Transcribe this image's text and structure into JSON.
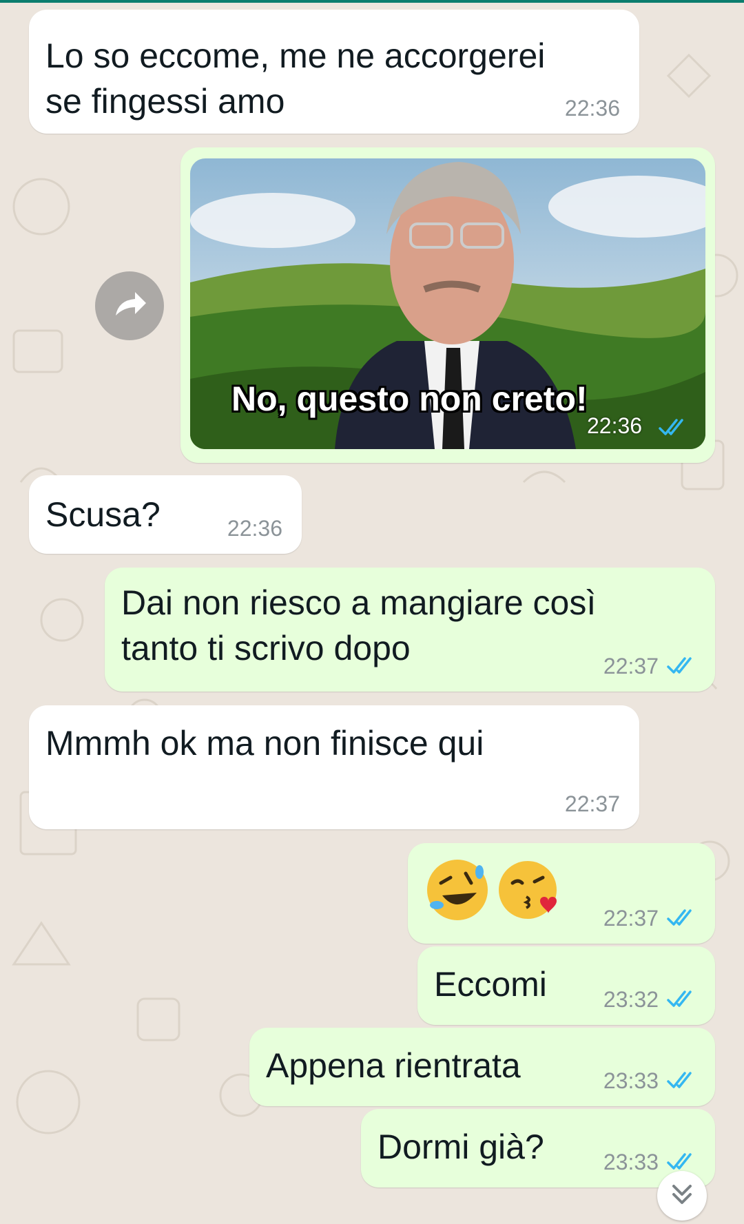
{
  "colors": {
    "chat_background": "#ece5dd",
    "incoming_bubble": "#ffffff",
    "outgoing_bubble": "#e7ffdb",
    "read_ticks": "#34b7f1",
    "header_accent": "#0b7d6e"
  },
  "messages": [
    {
      "direction": "incoming",
      "text": "Lo so eccome, me ne accorgerei\nse fingessi amo",
      "time": "22:36"
    },
    {
      "direction": "outgoing",
      "type": "gif",
      "caption_overlay": "No, questo non creto!",
      "time": "22:36",
      "status": "read",
      "forward_icon": "share-arrow-icon"
    },
    {
      "direction": "incoming",
      "text": "Scusa?",
      "time": "22:36"
    },
    {
      "direction": "outgoing",
      "text": "Dai non riesco a mangiare così\ntanto ti scrivo dopo",
      "time": "22:37",
      "status": "read"
    },
    {
      "direction": "incoming",
      "text": "Mmmh ok ma non finisce qui",
      "time": "22:37"
    },
    {
      "direction": "outgoing",
      "type": "emoji",
      "emojis": [
        "rolling-on-floor-laughing",
        "face-blowing-kiss"
      ],
      "time": "22:37",
      "status": "read"
    },
    {
      "direction": "outgoing",
      "text": "Eccomi",
      "time": "23:32",
      "status": "read"
    },
    {
      "direction": "outgoing",
      "text": "Appena rientrata",
      "time": "23:33",
      "status": "read"
    },
    {
      "direction": "outgoing",
      "text": "Dormi già?",
      "time": "23:33",
      "status": "read"
    }
  ],
  "scroll_button_icon": "chevron-double-down-icon"
}
